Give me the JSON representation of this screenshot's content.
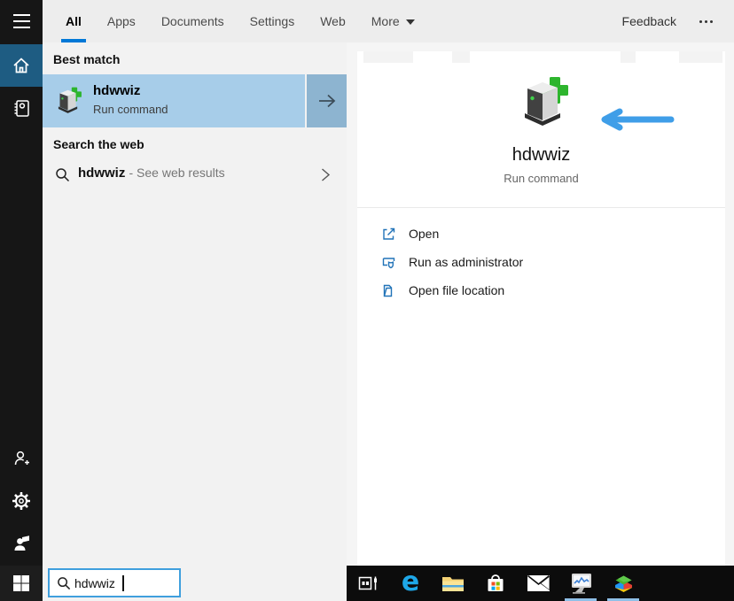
{
  "topbar": {
    "tabs": [
      {
        "label": "All",
        "selected": true
      },
      {
        "label": "Apps",
        "selected": false
      },
      {
        "label": "Documents",
        "selected": false
      },
      {
        "label": "Settings",
        "selected": false
      },
      {
        "label": "Web",
        "selected": false
      },
      {
        "label": "More",
        "selected": false,
        "has_dropdown": true
      }
    ],
    "feedback_label": "Feedback",
    "overflow_icon": "more-options-ellipsis"
  },
  "sidebar": {
    "items": [
      {
        "name": "menu",
        "icon": "hamburger-icon"
      },
      {
        "name": "home",
        "icon": "home-icon",
        "selected": true
      },
      {
        "name": "notebook",
        "icon": "notebook-icon"
      },
      {
        "name": "account",
        "icon": "user-add-icon"
      },
      {
        "name": "settings",
        "icon": "gear-icon"
      },
      {
        "name": "feedback",
        "icon": "person-feedback-icon"
      },
      {
        "name": "start",
        "icon": "windows-logo-icon"
      }
    ]
  },
  "results": {
    "best_match_header": "Best match",
    "best_match": {
      "title": "hdwwiz",
      "subtitle": "Run command",
      "icon": "add-hardware-icon"
    },
    "web_header": "Search the web",
    "web_row": {
      "query": "hdwwiz",
      "suffix": "- See web results",
      "icon": "search-icon"
    }
  },
  "detail": {
    "title": "hdwwiz",
    "subtitle": "Run command",
    "icon": "add-hardware-icon",
    "actions": [
      {
        "label": "Open",
        "icon": "open-icon"
      },
      {
        "label": "Run as administrator",
        "icon": "admin-shield-icon"
      },
      {
        "label": "Open file location",
        "icon": "folder-icon"
      }
    ]
  },
  "search_box": {
    "value": "hdwwiz",
    "placeholder": ""
  },
  "taskbar": {
    "icons": [
      {
        "name": "task-view",
        "running": false
      },
      {
        "name": "edge",
        "glyph": "e",
        "running": false
      },
      {
        "name": "file-explorer",
        "running": false
      },
      {
        "name": "microsoft-store",
        "running": false
      },
      {
        "name": "mail",
        "running": false
      },
      {
        "name": "system-monitor-app",
        "running": true
      },
      {
        "name": "bluestacks",
        "running": true
      }
    ]
  },
  "annotations": {
    "arrow": {
      "direction": "left",
      "color": "#3f9ee8"
    }
  },
  "colors": {
    "accent": "#0078d7",
    "best_match_highlight": "#a7cde9",
    "go_button": "#8db4d0",
    "sidebar_selected": "#1e5c82",
    "action_icon_blue": "#2173b8",
    "search_border": "#3f9fdd",
    "running_underline": "#8fc0e8"
  }
}
